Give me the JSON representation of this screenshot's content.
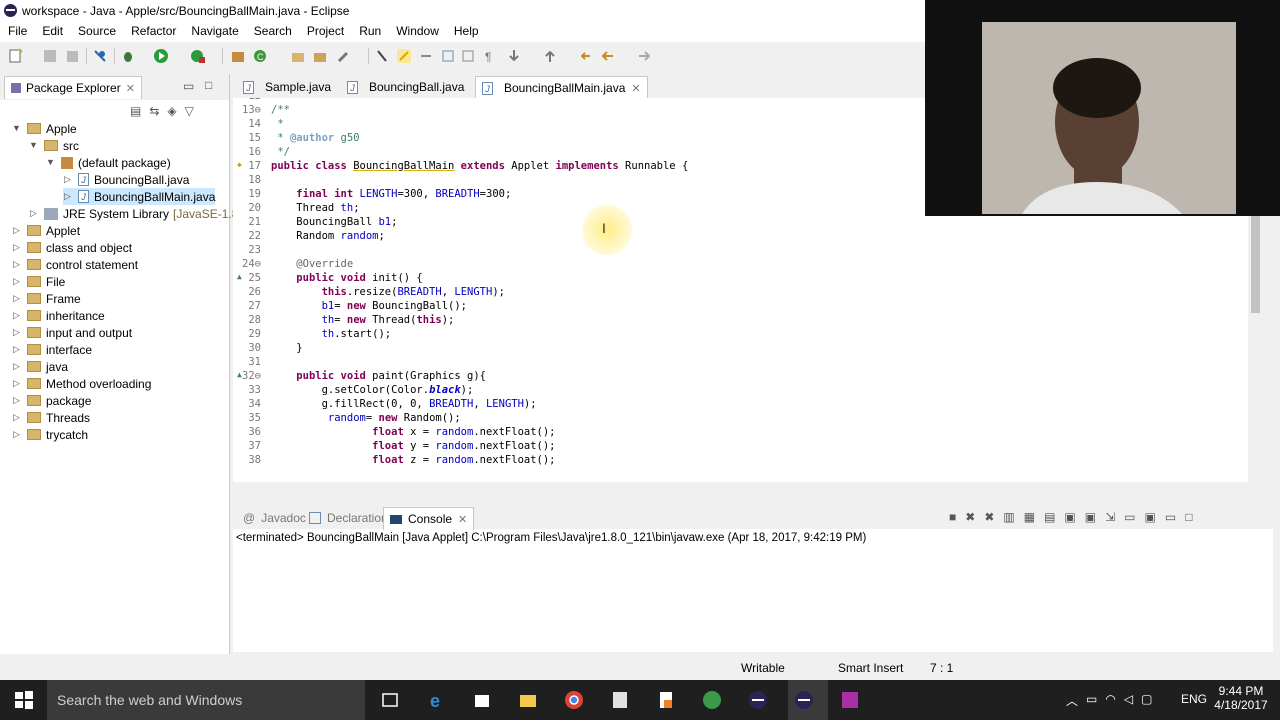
{
  "window": {
    "title": "workspace - Java - Apple/src/BouncingBallMain.java - Eclipse"
  },
  "menu": [
    "File",
    "Edit",
    "Source",
    "Refactor",
    "Navigate",
    "Search",
    "Project",
    "Run",
    "Window",
    "Help"
  ],
  "package_explorer": {
    "tab_label": "Package Explorer",
    "tree": [
      {
        "label": "Apple",
        "level": 0,
        "expanded": true,
        "kind": "project"
      },
      {
        "label": "src",
        "level": 1,
        "expanded": true,
        "kind": "folder"
      },
      {
        "label": "(default package)",
        "level": 2,
        "expanded": true,
        "kind": "package"
      },
      {
        "label": "BouncingBall.java",
        "level": 3,
        "expanded": false,
        "kind": "java"
      },
      {
        "label": "BouncingBallMain.java",
        "level": 3,
        "expanded": false,
        "kind": "java",
        "selected": true
      },
      {
        "label": "JRE System Library",
        "suffix": "[JavaSE-1.8]",
        "level": 1,
        "expanded": false,
        "kind": "jar"
      },
      {
        "label": "Applet",
        "level": 0,
        "expanded": false,
        "kind": "project"
      },
      {
        "label": "class and object",
        "level": 0,
        "expanded": false,
        "kind": "project"
      },
      {
        "label": "control statement",
        "level": 0,
        "expanded": false,
        "kind": "project"
      },
      {
        "label": "File",
        "level": 0,
        "expanded": false,
        "kind": "project"
      },
      {
        "label": "Frame",
        "level": 0,
        "expanded": false,
        "kind": "project"
      },
      {
        "label": "inheritance",
        "level": 0,
        "expanded": false,
        "kind": "project"
      },
      {
        "label": "input and output",
        "level": 0,
        "expanded": false,
        "kind": "project"
      },
      {
        "label": "interface",
        "level": 0,
        "expanded": false,
        "kind": "project"
      },
      {
        "label": "java",
        "level": 0,
        "expanded": false,
        "kind": "project"
      },
      {
        "label": "Method overloading",
        "level": 0,
        "expanded": false,
        "kind": "project"
      },
      {
        "label": "package",
        "level": 0,
        "expanded": false,
        "kind": "project"
      },
      {
        "label": "Threads",
        "level": 0,
        "expanded": false,
        "kind": "project"
      },
      {
        "label": "trycatch",
        "level": 0,
        "expanded": false,
        "kind": "project"
      }
    ]
  },
  "editor": {
    "tabs": [
      {
        "label": "Sample.java",
        "active": false
      },
      {
        "label": "BouncingBall.java",
        "active": false
      },
      {
        "label": "BouncingBallMain.java",
        "active": true
      }
    ],
    "lines": [
      {
        "n": "12",
        "html": ""
      },
      {
        "n": "13⊖",
        "html": "<span class='cm'>/**</span>"
      },
      {
        "n": "14",
        "html": "<span class='cm'> *</span>"
      },
      {
        "n": "15",
        "html": "<span class='cm'> * </span><span class='jd'>@author</span><span class='cm'> g50</span>"
      },
      {
        "n": "16",
        "html": "<span class='cm'> */</span>"
      },
      {
        "n": "17",
        "marker": "warn",
        "html": "<span class='kw'>public class</span> <u style='text-decoration-color:#d8b000'>BouncingBallMain</u> <span class='kw'>extends</span> Applet <span class='kw'>implements</span> Runnable {"
      },
      {
        "n": "18",
        "html": ""
      },
      {
        "n": "19",
        "html": "    <span class='kw'>final int</span> <span class='fld'>LENGTH</span>=300, <span class='fld'>BREADTH</span>=300;"
      },
      {
        "n": "20",
        "html": "    Thread <span class='fld'>th</span>;"
      },
      {
        "n": "21",
        "html": "    BouncingBall <span class='fld'>b1</span>;"
      },
      {
        "n": "22",
        "html": "    Random <span class='fld'>random</span>;"
      },
      {
        "n": "23",
        "html": ""
      },
      {
        "n": "24⊖",
        "html": "    <span class='ann'>@Override</span>"
      },
      {
        "n": "25",
        "marker": "ovr",
        "html": "    <span class='kw'>public void</span> init() {"
      },
      {
        "n": "26",
        "html": "        <span class='kw'>this</span>.resize(<span class='fld'>BREADTH</span>, <span class='fld'>LENGTH</span>);"
      },
      {
        "n": "27",
        "html": "        <span class='fld'>b1</span>= <span class='kw'>new</span> BouncingBall();"
      },
      {
        "n": "28",
        "html": "        <span class='fld'>th</span>= <span class='kw'>new</span> Thread(<span class='kw'>this</span>);"
      },
      {
        "n": "29",
        "html": "        <span class='fld'>th</span>.start();"
      },
      {
        "n": "30",
        "html": "    }"
      },
      {
        "n": "31",
        "html": ""
      },
      {
        "n": "32⊖",
        "marker": "ovr",
        "html": "    <span class='kw'>public void</span> paint(Graphics <u style='text-decoration-color:#d8b000'>g</u>){"
      },
      {
        "n": "33",
        "html": "        <u style='text-decoration-color:#d8b000'>g</u>.setColor(Color.<span class='fld' style='font-style:italic;font-weight:bold'>black</span>);"
      },
      {
        "n": "34",
        "html": "        <u style='text-decoration-color:#d8b000'>g</u>.fillRect(0, 0, <span class='fld'>BREADTH</span>, <span class='fld'>LENGTH</span>);"
      },
      {
        "n": "35",
        "html": "         <span class='fld'>random</span>= <span class='kw'>new</span> Random();"
      },
      {
        "n": "36",
        "html": "                <span class='kw'>float</span> x = <span class='fld'>random</span>.nextFloat();"
      },
      {
        "n": "37",
        "html": "                <span class='kw'>float</span> y = <span class='fld'>random</span>.nextFloat();"
      },
      {
        "n": "38",
        "html": "                <span class='kw'>float</span> z = <span class='fld'>random</span>.nextFloat();"
      }
    ]
  },
  "bottom_panel": {
    "tabs": [
      {
        "label": "Javadoc",
        "active": false
      },
      {
        "label": "Declaration",
        "active": false
      },
      {
        "label": "Console",
        "active": true
      }
    ],
    "console_text": "<terminated> BouncingBallMain [Java Applet] C:\\Program Files\\Java\\jre1.8.0_121\\bin\\javaw.exe (Apr 18, 2017, 9:42:19 PM)"
  },
  "status": {
    "writable": "Writable",
    "insert_mode": "Smart Insert",
    "position": "7 : 1"
  },
  "taskbar": {
    "search_placeholder": "Search the web and Windows",
    "language": "ENG",
    "time": "9:44 PM",
    "date": "4/18/2017"
  },
  "colors": {
    "keyword": "#7f0055",
    "comment": "#3f7f5f",
    "field": "#0000c0",
    "selection": "#cce8ff",
    "taskbar": "#1f1f1f"
  }
}
